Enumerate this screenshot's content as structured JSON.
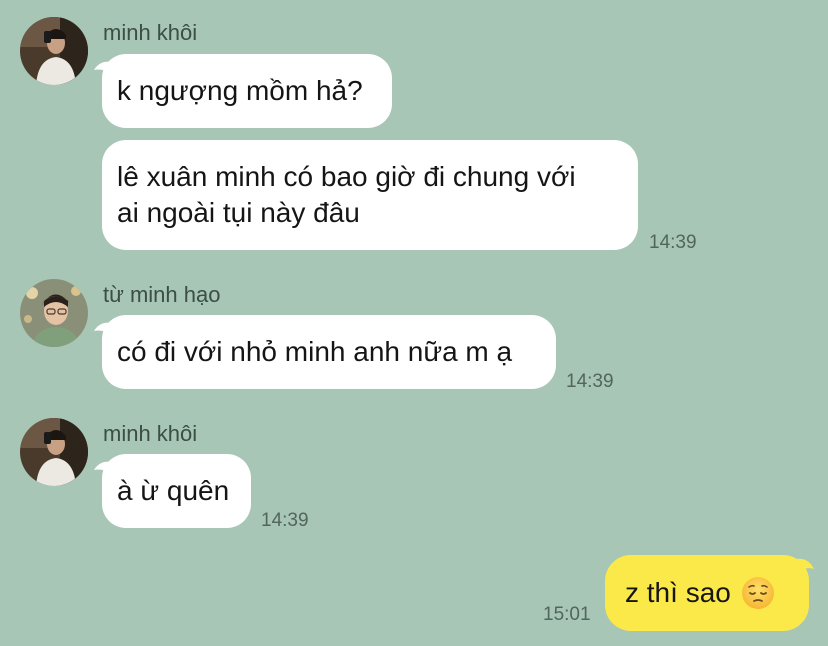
{
  "messages": [
    {
      "sender": "minh khôi",
      "bubbles": [
        {
          "text": "k ngượng mồm hả?"
        },
        {
          "line1": "lê xuân minh có bao giờ đi chung với",
          "line2": "ai ngoài tụi này đâu",
          "time": "14:39"
        }
      ]
    },
    {
      "sender": "từ minh hạo",
      "bubbles": [
        {
          "text": "có đi với nhỏ minh anh nữa m ạ",
          "time": "14:39"
        }
      ]
    },
    {
      "sender": "minh khôi",
      "bubbles": [
        {
          "text": "à ừ quên",
          "time": "14:39"
        }
      ]
    }
  ],
  "outgoing": {
    "text": "z thì sao",
    "emoji": "pensive-face-icon",
    "time": "15:01"
  },
  "colors": {
    "background": "#a7c6b6",
    "incoming_bubble": "#ffffff",
    "outgoing_bubble": "#fbe94a"
  }
}
